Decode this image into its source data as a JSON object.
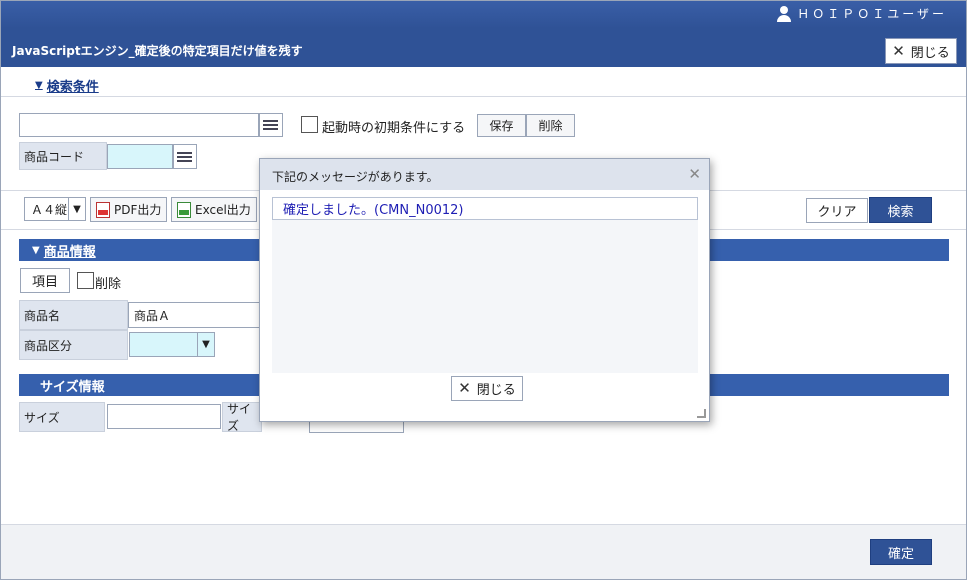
{
  "header": {
    "user_name": "ＨＯＩＰＯＩユーザー",
    "page_title": "JavaScriptエンジン_確定後の特定項目だけ値を残す",
    "close_label": "閉じる"
  },
  "search": {
    "toggle_label": "検索条件",
    "startup_checkbox_label": "起動時の初期条件にする",
    "save_label": "保存",
    "delete_label": "削除",
    "product_code_label": "商品コード"
  },
  "toolbar": {
    "paper_size": "Ａ４縦",
    "pdf_label": "PDF出力",
    "excel_label": "Excel出力",
    "clear_label": "クリア",
    "search_label": "検索"
  },
  "product_section": {
    "title": "商品情報",
    "item_button": "項目",
    "delete_checkbox_label": "削除",
    "name_label": "商品名",
    "name_value": "商品Ａ",
    "category_label": "商品区分"
  },
  "size_section": {
    "title": "サイズ情報",
    "size_label": "サイズ",
    "size_label_2": "サイズ"
  },
  "footer": {
    "confirm_label": "確定"
  },
  "dialog": {
    "title": "下記のメッセージがあります。",
    "message": "確定しました。(CMN_N0012)",
    "close_label": "閉じる"
  },
  "colors": {
    "brand": "#2f5296",
    "section": "#3660ad",
    "message_text": "#1e1eb4",
    "input_highlight": "#d8f6fb"
  }
}
